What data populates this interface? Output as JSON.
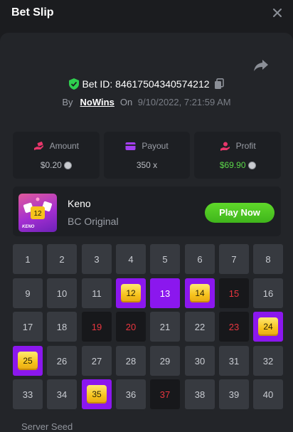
{
  "header": {
    "title": "Bet Slip"
  },
  "bet": {
    "id_label": "Bet ID: 84617504340574212",
    "by_label": "By",
    "username": "NoWins",
    "on_label": "On",
    "datetime": "9/10/2022, 7:21:59 AM"
  },
  "stats": {
    "amount": {
      "label": "Amount",
      "value": "$0.20"
    },
    "payout": {
      "label": "Payout",
      "value": "350 x"
    },
    "profit": {
      "label": "Profit",
      "value": "$69.90"
    }
  },
  "game": {
    "name": "Keno",
    "provider": "BC Original",
    "play_label": "Play Now",
    "thumb_label": "KENO",
    "thumb_number": "12"
  },
  "grid": {
    "numbers": [
      "1",
      "2",
      "3",
      "4",
      "5",
      "6",
      "7",
      "8",
      "9",
      "10",
      "11",
      "12",
      "13",
      "14",
      "15",
      "16",
      "17",
      "18",
      "19",
      "20",
      "21",
      "22",
      "23",
      "24",
      "25",
      "26",
      "27",
      "28",
      "29",
      "30",
      "31",
      "32",
      "33",
      "34",
      "35",
      "36",
      "37",
      "38",
      "39",
      "40"
    ],
    "states": [
      "n",
      "n",
      "n",
      "n",
      "n",
      "n",
      "n",
      "n",
      "n",
      "n",
      "n",
      "p",
      "h",
      "p",
      "d",
      "n",
      "n",
      "n",
      "d",
      "d",
      "n",
      "n",
      "d",
      "p",
      "p",
      "n",
      "n",
      "n",
      "n",
      "n",
      "n",
      "n",
      "n",
      "n",
      "p",
      "n",
      "d",
      "n",
      "n",
      "n"
    ]
  },
  "footer": {
    "server_seed_label": "Server Seed"
  },
  "colors": {
    "accent_purple": "#8b17ee",
    "play_green": "#4cc722",
    "profit_green": "#5cd84a",
    "drawn_red": "#e8363f",
    "gem_gold": "#f6c21c"
  },
  "icons": {
    "close": "close-icon",
    "share": "share-icon",
    "verified": "shield-check-icon",
    "copy": "copy-icon",
    "amount": "money-hand-icon",
    "payout": "wallet-icon",
    "profit": "profit-hand-icon",
    "coin": "coin-icon"
  }
}
